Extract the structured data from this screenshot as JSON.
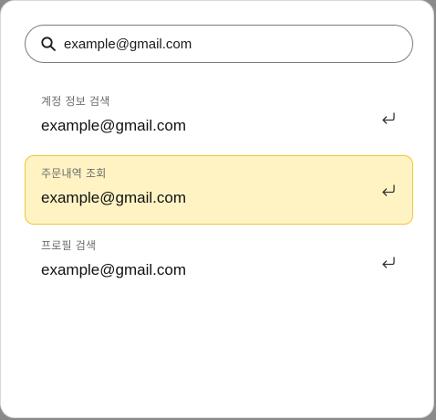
{
  "search": {
    "icon": "search-icon",
    "value": "example@gmail.com"
  },
  "results": [
    {
      "label": "계정 정보 검색",
      "value": "example@gmail.com",
      "icon": "enter-icon",
      "active": false
    },
    {
      "label": "주문내역 조회",
      "value": "example@gmail.com",
      "icon": "enter-icon",
      "active": true
    },
    {
      "label": "프로필 검색",
      "value": "example@gmail.com",
      "icon": "enter-icon",
      "active": false
    }
  ],
  "colors": {
    "highlight_bg": "#fff3c4",
    "highlight_border": "#f0c536"
  }
}
